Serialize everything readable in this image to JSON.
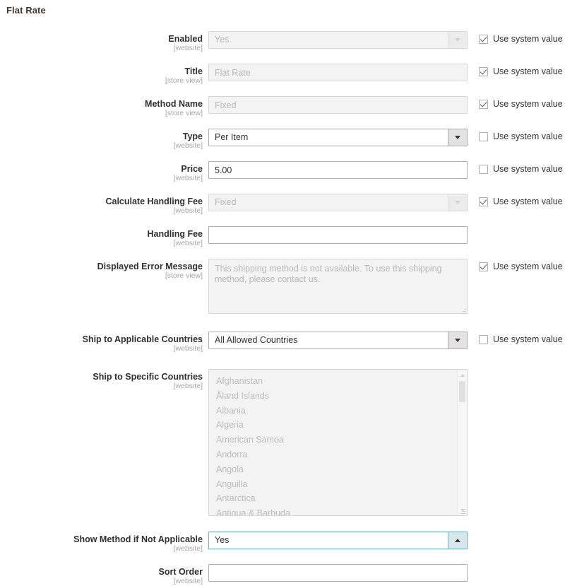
{
  "section": {
    "title": "Flat Rate"
  },
  "system_value_label": "Use system value",
  "colors": {
    "focus_border": "#7fb6c4",
    "heading": "#41362f",
    "label": "#303030",
    "scope": "#a6a6a6",
    "disabled_text": "#b9b9b9"
  },
  "fields": [
    {
      "label": "Enabled",
      "scope": "[website]",
      "control": "select",
      "value": "Yes",
      "disabled": true,
      "arrow": "chevron-down-icon",
      "use_system_value": true
    },
    {
      "label": "Title",
      "scope": "[store view]",
      "control": "text",
      "value": "Flat Rate",
      "disabled": true,
      "use_system_value": true
    },
    {
      "label": "Method Name",
      "scope": "[store view]",
      "control": "text",
      "value": "Fixed",
      "disabled": true,
      "use_system_value": true
    },
    {
      "label": "Type",
      "scope": "[website]",
      "control": "select",
      "value": "Per Item",
      "disabled": false,
      "arrow": "chevron-down-icon",
      "use_system_value": false
    },
    {
      "label": "Price",
      "scope": "[website]",
      "control": "text",
      "value": "5.00",
      "disabled": false,
      "use_system_value": false
    },
    {
      "label": "Calculate Handling Fee",
      "scope": "[website]",
      "control": "select",
      "value": "Fixed",
      "disabled": true,
      "arrow": "chevron-down-icon",
      "use_system_value": true
    },
    {
      "label": "Handling Fee",
      "scope": "[website]",
      "control": "text",
      "value": "",
      "disabled": false,
      "use_system_value": null
    },
    {
      "label": "Displayed Error Message",
      "scope": "[store view]",
      "control": "textarea",
      "value": "This shipping method is not available. To use this shipping method, please contact us.",
      "disabled": true,
      "use_system_value": true
    },
    {
      "label": "Ship to Applicable Countries",
      "scope": "[website]",
      "control": "select",
      "value": "All Allowed Countries",
      "disabled": false,
      "arrow": "chevron-down-icon",
      "use_system_value": false
    },
    {
      "label": "Ship to Specific Countries",
      "scope": "[website]",
      "control": "multiselect",
      "disabled": true,
      "options": [
        "Afghanistan",
        "Åland Islands",
        "Albania",
        "Algeria",
        "American Samoa",
        "Andorra",
        "Angola",
        "Anguilla",
        "Antarctica",
        "Antigua & Barbuda"
      ],
      "use_system_value": null
    },
    {
      "label": "Show Method if Not Applicable",
      "scope": "[website]",
      "control": "select",
      "value": "Yes",
      "disabled": false,
      "focused": true,
      "arrow": "chevron-up-icon",
      "use_system_value": null
    },
    {
      "label": "Sort Order",
      "scope": "[website]",
      "control": "text",
      "value": "",
      "disabled": false,
      "use_system_value": null
    }
  ]
}
